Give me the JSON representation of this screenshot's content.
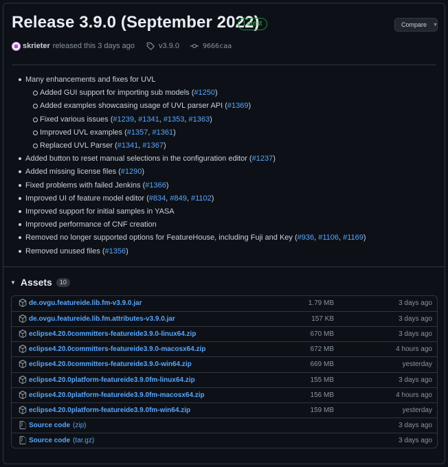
{
  "release": {
    "title": "Release 3.9.0 (September 2022)",
    "badge": "Latest",
    "compare_label": "Compare",
    "author": "skrieter",
    "released_text": "released this 3 days ago",
    "tag": "v3.9.0",
    "commit": "9666caa"
  },
  "notes": [
    {
      "level": 1,
      "text": "Many enhancements and fixes for UVL",
      "links": []
    },
    {
      "level": 2,
      "text": "Added GUI support for importing sub models (",
      "links": [
        "#1250"
      ],
      "tail": ")"
    },
    {
      "level": 2,
      "text": "Added examples showcasing usage of UVL parser API (",
      "links": [
        "#1369"
      ],
      "tail": ")"
    },
    {
      "level": 2,
      "text": "Fixed various issues (",
      "links": [
        "#1239",
        "#1341",
        "#1353",
        "#1363"
      ],
      "tail": ")"
    },
    {
      "level": 2,
      "text": "Improved UVL examples (",
      "links": [
        "#1357",
        "#1361"
      ],
      "tail": ")"
    },
    {
      "level": 2,
      "text": "Replaced UVL Parser (",
      "links": [
        "#1341",
        "#1367"
      ],
      "tail": ")"
    },
    {
      "level": 1,
      "text": "Added button to reset manual selections in the configuration editor (",
      "links": [
        "#1237"
      ],
      "tail": ")"
    },
    {
      "level": 1,
      "text": "Added missing license files (",
      "links": [
        "#1290"
      ],
      "tail": ")"
    },
    {
      "level": 1,
      "text": "Fixed problems with failed Jenkins (",
      "links": [
        "#1366"
      ],
      "tail": ")"
    },
    {
      "level": 1,
      "text": "Improved UI of feature model editor (",
      "links": [
        "#834",
        "#849",
        "#1102"
      ],
      "tail": ")"
    },
    {
      "level": 1,
      "text": "Improved support for initial samples in YASA",
      "links": []
    },
    {
      "level": 1,
      "text": "Improved performance of CNF creation",
      "links": []
    },
    {
      "level": 1,
      "text": "Removed no longer supported options for FeatureHouse, including Fuji and Key (",
      "links": [
        "#936",
        "#1106",
        "#1169"
      ],
      "tail": ")"
    },
    {
      "level": 1,
      "text": "Removed unused files (",
      "links": [
        "#1356"
      ],
      "tail": ")"
    }
  ],
  "assets": {
    "label": "Assets",
    "count": "10",
    "files": [
      {
        "name": "de.ovgu.featureide.lib.fm-v3.9.0.jar",
        "size": "1.79 MB",
        "time": "3 days ago",
        "icon": "package-icon"
      },
      {
        "name": "de.ovgu.featureide.lib.fm.attributes-v3.9.0.jar",
        "size": "157 KB",
        "time": "3 days ago",
        "icon": "package-icon"
      },
      {
        "name": "eclipse4.20.0committers-featureide3.9.0-linux64.zip",
        "size": "670 MB",
        "time": "3 days ago",
        "icon": "package-icon"
      },
      {
        "name": "eclipse4.20.0committers-featureide3.9.0-macosx64.zip",
        "size": "672 MB",
        "time": "4 hours ago",
        "icon": "package-icon"
      },
      {
        "name": "eclipse4.20.0committers-featureide3.9.0-win64.zip",
        "size": "669 MB",
        "time": "yesterday",
        "icon": "package-icon"
      },
      {
        "name": "eclipse4.20.0platform-featureide3.9.0fm-linux64.zip",
        "size": "155 MB",
        "time": "3 days ago",
        "icon": "package-icon"
      },
      {
        "name": "eclipse4.20.0platform-featureide3.9.0fm-macosx64.zip",
        "size": "156 MB",
        "time": "4 hours ago",
        "icon": "package-icon"
      },
      {
        "name": "eclipse4.20.0platform-featureide3.9.0fm-win64.zip",
        "size": "159 MB",
        "time": "yesterday",
        "icon": "package-icon"
      },
      {
        "name": "Source code",
        "format": "(zip)",
        "size": "",
        "time": "3 days ago",
        "icon": "file-zip-icon"
      },
      {
        "name": "Source code",
        "format": "(tar.gz)",
        "size": "",
        "time": "3 days ago",
        "icon": "file-zip-icon"
      }
    ]
  }
}
